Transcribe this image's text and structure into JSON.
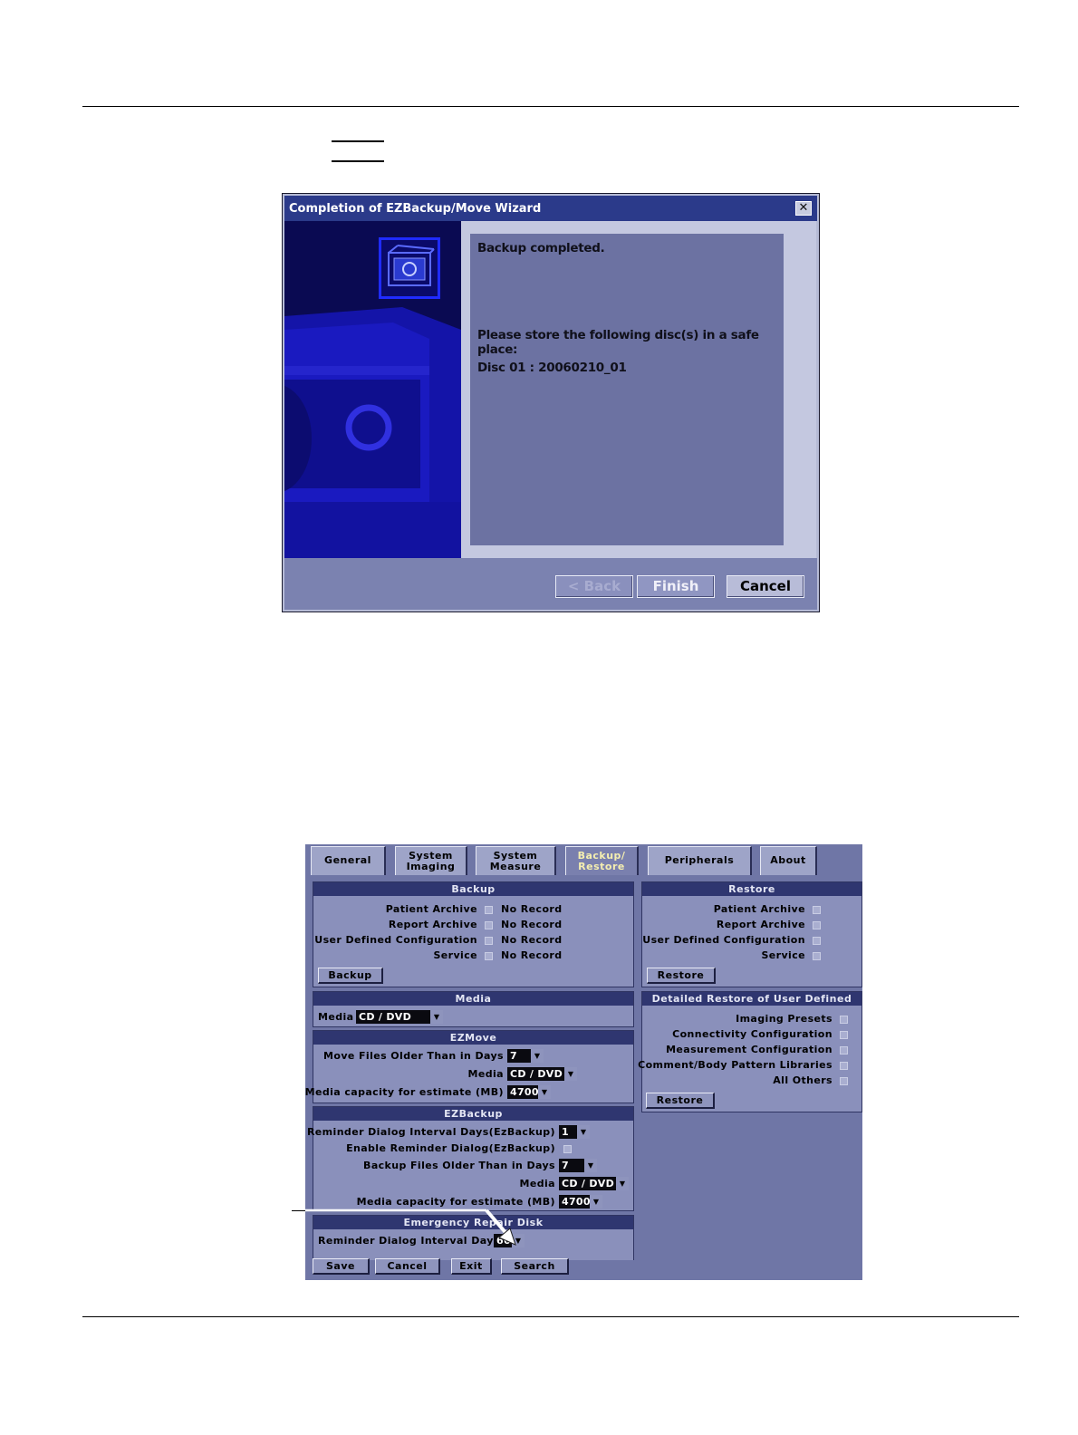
{
  "wizard": {
    "title": "Completion of EZBackup/Move Wizard",
    "close_glyph": "✕",
    "message_line1": "Backup completed.",
    "message_line2": "Please store the following disc(s) in a safe place:",
    "message_line3": "Disc 01 : 20060210_01",
    "back_label": "< Back",
    "finish_label": "Finish",
    "cancel_label": "Cancel",
    "icon": "backup-disc-icon",
    "colors": {
      "title_bar": "#2b3a8a",
      "left_panel": "#0a0a52",
      "message_box": "#6c72a2"
    }
  },
  "utility": {
    "tabs": [
      {
        "line1": "General",
        "line2": ""
      },
      {
        "line1": "System",
        "line2": "Imaging"
      },
      {
        "line1": "System",
        "line2": "Measure"
      },
      {
        "line1": "Backup/",
        "line2": "Restore"
      },
      {
        "line1": "Peripherals",
        "line2": ""
      },
      {
        "line1": "About",
        "line2": ""
      }
    ],
    "active_tab": "Backup/ Restore",
    "backup": {
      "title": "Backup",
      "items": [
        {
          "label": "Patient Archive",
          "status": "No Record"
        },
        {
          "label": "Report Archive",
          "status": "No Record"
        },
        {
          "label": "User Defined Configuration",
          "status": "No Record"
        },
        {
          "label": "Service",
          "status": "No Record"
        }
      ],
      "button": "Backup"
    },
    "restore": {
      "title": "Restore",
      "items": [
        "Patient Archive",
        "Report Archive",
        "User Defined Configuration",
        "Service"
      ],
      "button": "Restore"
    },
    "media": {
      "title": "Media",
      "label": "Media",
      "value": "CD / DVD"
    },
    "detailed_restore": {
      "title": "Detailed Restore of User Defined",
      "items": [
        "Imaging Presets",
        "Connectivity Configuration",
        "Measurement Configuration",
        "Comment/Body Pattern Libraries",
        "All Others"
      ],
      "button": "Restore"
    },
    "ezmove": {
      "title": "EZMove",
      "days_label": "Move Files Older Than in Days",
      "days_value": "7",
      "media_label": "Media",
      "media_value": "CD / DVD",
      "capacity_label": "Media capacity for estimate (MB)",
      "capacity_value": "4700"
    },
    "ezbackup": {
      "title": "EZBackup",
      "interval_label": "Reminder Dialog Interval Days(EzBackup)",
      "interval_value": "1",
      "enable_label": "Enable Reminder Dialog(EzBackup)",
      "days_label": "Backup Files Older Than in Days",
      "days_value": "7",
      "media_label": "Media",
      "media_value": "CD / DVD",
      "capacity_label": "Media capacity for estimate (MB)",
      "capacity_value": "4700"
    },
    "emergency": {
      "title": "Emergency Repair Disk",
      "interval_label": "Reminder Dialog Interval Days",
      "interval_value": "60"
    },
    "bottom_buttons": {
      "save": "Save",
      "cancel": "Cancel",
      "exit": "Exit",
      "search": "Search"
    }
  }
}
